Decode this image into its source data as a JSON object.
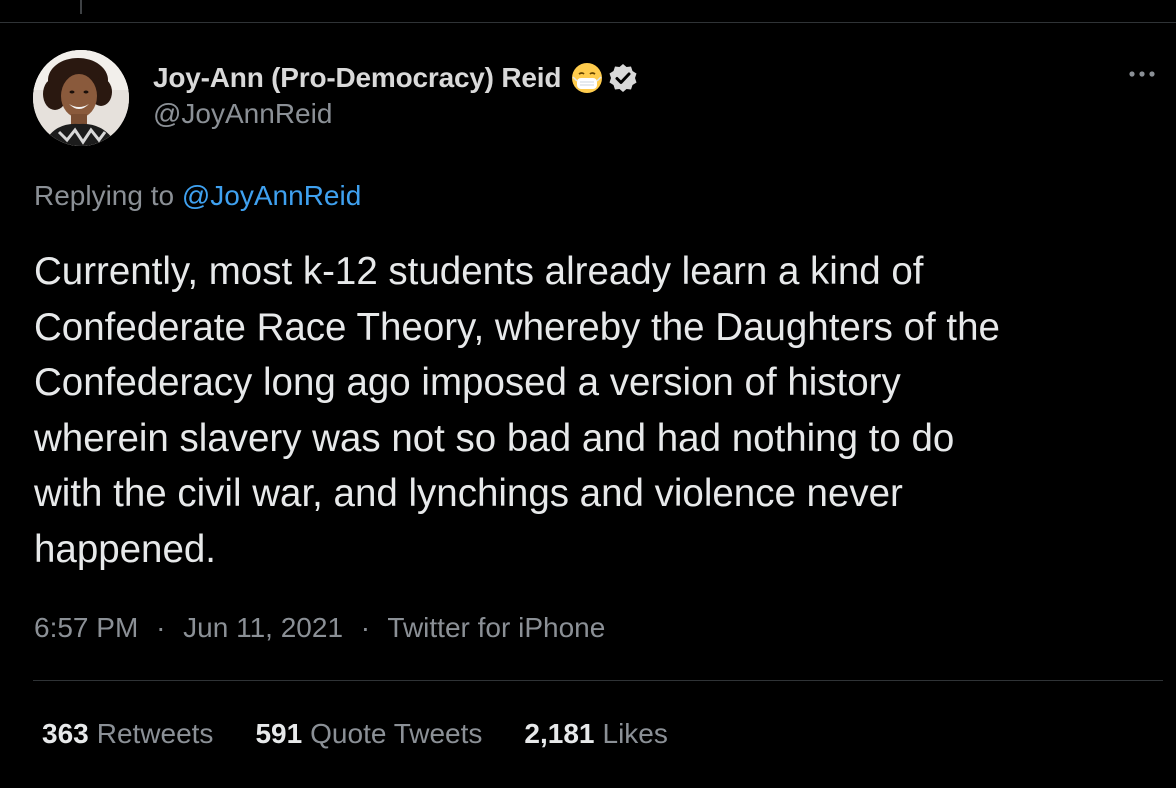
{
  "tweet": {
    "author": {
      "display_name": "Joy-Ann (Pro-Democracy) Reid",
      "handle": "@JoyAnnReid",
      "emoji": "face-with-medical-mask-icon",
      "verified_icon": "verified-badge-icon"
    },
    "replying_prefix": "Replying to",
    "replying_to": "@JoyAnnReid",
    "text_lines": [
      "Currently, most k-12 students already learn a kind of",
      "Confederate Race Theory, whereby the Daughters of the",
      "Confederacy long ago imposed a version of history",
      "wherein slavery was not so bad and had nothing to do",
      "with the civil war, and lynchings and violence never",
      "happened."
    ],
    "time": "6:57 PM",
    "separator": "·",
    "date": "Jun 11, 2021",
    "source": "Twitter for iPhone",
    "stats": {
      "retweets_count": "363",
      "retweets_label": "Retweets",
      "quotes_count": "591",
      "quotes_label": "Quote Tweets",
      "likes_count": "2,181",
      "likes_label": "Likes"
    }
  },
  "colors": {
    "background": "#000000",
    "primary_text": "#e7e9ea",
    "secondary_text": "#8b9096",
    "link": "#3fa1f0",
    "divider": "#2f3336"
  }
}
